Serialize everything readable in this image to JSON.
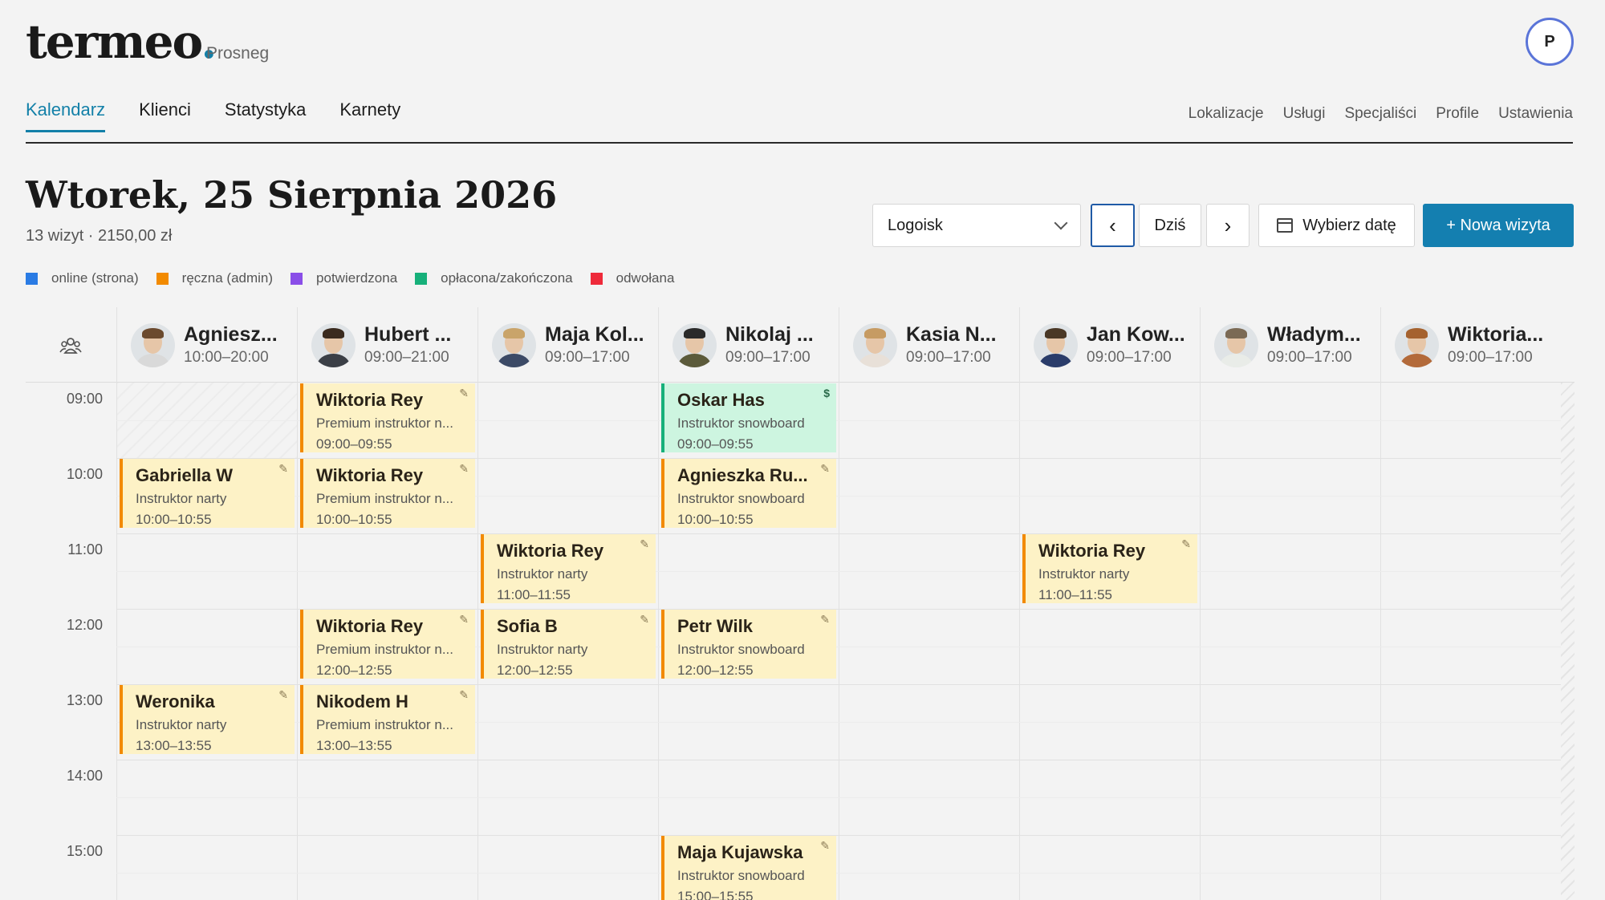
{
  "app": {
    "logo": "termeo",
    "logo_dot": ".",
    "business": "Prosneg",
    "user_initial": "P"
  },
  "nav": {
    "main": [
      "Kalendarz",
      "Klienci",
      "Statystyka",
      "Karnety"
    ],
    "active": "Kalendarz",
    "secondary": [
      "Lokalizacje",
      "Usługi",
      "Specjaliści",
      "Profile",
      "Ustawienia"
    ]
  },
  "day": {
    "title": "Wtorek, 25 Sierpnia 2026",
    "summary": "13 wizyt · 2150,00 zł"
  },
  "legend": [
    {
      "label": "online (strona)",
      "color": "#2a7be4"
    },
    {
      "label": "ręczna (admin)",
      "color": "#f28a00"
    },
    {
      "label": "potwierdzona",
      "color": "#8a4ee8"
    },
    {
      "label": "opłacona/zakończona",
      "color": "#17b07a"
    },
    {
      "label": "odwołana",
      "color": "#ee2a3a"
    }
  ],
  "toolbar": {
    "location": "Logoisk",
    "prev": "‹",
    "today": "Dziś",
    "next": "›",
    "pick_date": "Wybierz datę",
    "new_visit": "+ Nowa wizyta"
  },
  "staff": [
    {
      "name": "Agniesz...",
      "hours": "10:00–20:00",
      "shirt": "#d9d9d9",
      "hair": "#6b4a2e"
    },
    {
      "name": "Hubert ...",
      "hours": "09:00–21:00",
      "shirt": "#3b3f46",
      "hair": "#3a2a1e"
    },
    {
      "name": "Maja Kol...",
      "hours": "09:00–17:00",
      "shirt": "#3c4a66",
      "hair": "#c9a46a"
    },
    {
      "name": "Nikolaj ...",
      "hours": "09:00–17:00",
      "shirt": "#5b5a3a",
      "hair": "#2a2a2a"
    },
    {
      "name": "Kasia N...",
      "hours": "09:00–17:00",
      "shirt": "#e8e0d8",
      "hair": "#c69b63"
    },
    {
      "name": "Jan Kow...",
      "hours": "09:00–17:00",
      "shirt": "#2a3c6a",
      "hair": "#4a3826"
    },
    {
      "name": "Władym...",
      "hours": "09:00–17:00",
      "shirt": "#e9ece8",
      "hair": "#7b6a55"
    },
    {
      "name": "Wiktoria...",
      "hours": "09:00–17:00",
      "shirt": "#b36a3a",
      "hair": "#a5622f"
    }
  ],
  "times": [
    "09:00",
    "10:00",
    "11:00",
    "12:00",
    "13:00",
    "14:00",
    "15:00"
  ],
  "appointments": [
    {
      "col": 1,
      "start": 9,
      "name": "Wiktoria Rey",
      "service": "Premium instruktor n...",
      "time": "09:00–09:55",
      "status": "manual",
      "corner": "✎"
    },
    {
      "col": 3,
      "start": 9,
      "name": "Oskar Has",
      "service": "Instruktor snowboard",
      "time": "09:00–09:55",
      "status": "paid",
      "corner": "$"
    },
    {
      "col": 0,
      "start": 10,
      "name": "Gabriella W",
      "service": "Instruktor narty",
      "time": "10:00–10:55",
      "status": "manual",
      "corner": "✎"
    },
    {
      "col": 1,
      "start": 10,
      "name": "Wiktoria Rey",
      "service": "Premium instruktor n...",
      "time": "10:00–10:55",
      "status": "manual",
      "corner": "✎"
    },
    {
      "col": 3,
      "start": 10,
      "name": "Agnieszka Ru...",
      "service": "Instruktor snowboard",
      "time": "10:00–10:55",
      "status": "manual",
      "corner": "✎"
    },
    {
      "col": 2,
      "start": 11,
      "name": "Wiktoria Rey",
      "service": "Instruktor narty",
      "time": "11:00–11:55",
      "status": "manual",
      "corner": "✎"
    },
    {
      "col": 5,
      "start": 11,
      "name": "Wiktoria Rey",
      "service": "Instruktor narty",
      "time": "11:00–11:55",
      "status": "manual",
      "corner": "✎"
    },
    {
      "col": 1,
      "start": 12,
      "name": "Wiktoria Rey",
      "service": "Premium instruktor n...",
      "time": "12:00–12:55",
      "status": "manual",
      "corner": "✎"
    },
    {
      "col": 2,
      "start": 12,
      "name": "Sofia B",
      "service": "Instruktor narty",
      "time": "12:00–12:55",
      "status": "manual",
      "corner": "✎"
    },
    {
      "col": 3,
      "start": 12,
      "name": "Petr Wilk",
      "service": "Instruktor snowboard",
      "time": "12:00–12:55",
      "status": "manual",
      "corner": "✎"
    },
    {
      "col": 0,
      "start": 13,
      "name": "Weronika",
      "service": "Instruktor narty",
      "time": "13:00–13:55",
      "status": "manual",
      "corner": "✎"
    },
    {
      "col": 1,
      "start": 13,
      "name": "Nikodem H",
      "service": "Premium instruktor n...",
      "time": "13:00–13:55",
      "status": "manual",
      "corner": "✎"
    },
    {
      "col": 3,
      "start": 15,
      "name": "Maja Kujawska",
      "service": "Instruktor snowboard",
      "time": "15:00–15:55",
      "status": "manual",
      "corner": "✎"
    }
  ]
}
